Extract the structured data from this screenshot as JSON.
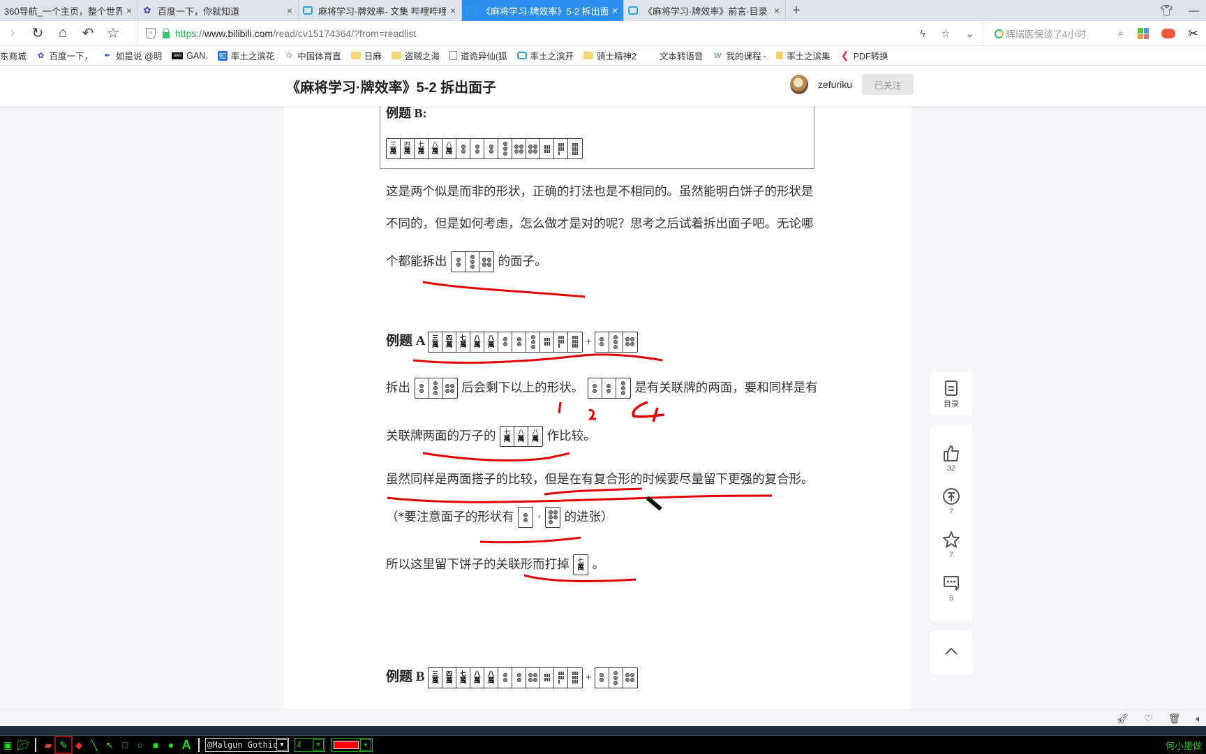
{
  "browser": {
    "tabs": [
      {
        "label": "360导航_一个主页，整个世界",
        "icon": "globe-icon",
        "active": false
      },
      {
        "label": "百度一下，你就知道",
        "icon": "baidu-paw-icon",
        "active": false
      },
      {
        "label": "麻将学习·牌效率- 文集 哔哩哔哩",
        "icon": "bilibili-tv-icon",
        "active": false
      },
      {
        "label": "《麻将学习·牌效率》5-2 拆出面子",
        "icon": "bilibili-tv-icon",
        "active": true
      },
      {
        "label": "《麻将学习·牌效率》前言·目录",
        "icon": "bilibili-tv-icon",
        "active": false
      }
    ],
    "close_glyph": "×",
    "new_tab_glyph": "+",
    "url": {
      "scheme": "https",
      "sep": "://",
      "host": "www.bilibili.com",
      "path": "/read/cv15174364/?from=readlist"
    },
    "search_placeholder": "辉瑞医保谈了4小时",
    "bookmarks": [
      {
        "label": "东商城",
        "icon": "none"
      },
      {
        "label": "百度一下，",
        "icon": "baidu-paw-icon"
      },
      {
        "label": "如是说 @明",
        "icon": "quill-icon"
      },
      {
        "label": "GAN.",
        "icon": "gan-icon"
      },
      {
        "label": "率土之滨花",
        "icon": "zhihu-icon"
      },
      {
        "label": "中国体育直",
        "icon": "star-badge-icon"
      },
      {
        "label": "日麻",
        "icon": "folder-icon"
      },
      {
        "label": "盗贼之海",
        "icon": "folder-icon"
      },
      {
        "label": "道诡异仙(狐",
        "icon": "page-icon"
      },
      {
        "label": "率土之滨开",
        "icon": "bilibili-tv-icon"
      },
      {
        "label": "骑士精神2",
        "icon": "folder-icon"
      },
      {
        "label": "文本转语音",
        "icon": "microsoft-icon"
      },
      {
        "label": "我的课程 -",
        "icon": "wings-icon"
      },
      {
        "label": "率土之滨集",
        "icon": "note-icon"
      },
      {
        "label": "PDF转换",
        "icon": "pdf-icon"
      }
    ]
  },
  "page": {
    "title": "《麻将学习·牌效率》5-2 拆出面子",
    "author": "zefuriku",
    "follow_label": "已关注"
  },
  "article": {
    "example_b_box_label": "例题 B:",
    "example_b_box_tiles": [
      "3m",
      "4m",
      "7m",
      "8m",
      "8m",
      "2p",
      "2p",
      "2p",
      "3p",
      "4p",
      "4p",
      "6s",
      "7s",
      "9s"
    ],
    "p1_line1": "这是两个似是而非的形状，正确的打法也是不相同的。虽然能明白饼子的形状是",
    "p1_line2": "不同的，但是如何考虑，怎么做才是对的呢？思考之后试着拆出面子吧。无论哪",
    "p1_line3_a": "个都能拆出",
    "p1_line3_tiles": [
      "2p",
      "3p",
      "4p"
    ],
    "p1_line3_b": "的面子。",
    "example_a_label": "例题 A",
    "example_a_tiles": [
      "3m",
      "4m",
      "7m",
      "8m",
      "8m",
      "2p",
      "2p",
      "3p",
      "6s",
      "7s",
      "9s"
    ],
    "example_a_plus": "+",
    "example_a_extra": [
      "2p",
      "3p",
      "4p"
    ],
    "p2_a": "拆出",
    "p2_tiles1": [
      "2p",
      "3p",
      "4p"
    ],
    "p2_b": "后会剩下以上的形状。",
    "p2_tiles2": [
      "2p",
      "2p",
      "3p"
    ],
    "p2_c": "是有关联牌的两面，要和同样是有",
    "p3_a": "关联牌两面的万子的",
    "p3_tiles": [
      "7m",
      "8m",
      "8m"
    ],
    "p3_b": "作比较。",
    "p4": "虽然同样是两面搭子的比较，但是在有复合形的时候要尽量留下更强的复合形。",
    "p5_a": "（*要注意面子的形状有",
    "p5_tile1": [
      "2p"
    ],
    "p5_dot": "·",
    "p5_tile2": [
      "5p"
    ],
    "p5_b": "的进张）",
    "p6_a": "所以这里留下饼子的关联形而打掉",
    "p6_tile": [
      "7m"
    ],
    "p6_b": "。",
    "example_b_label": "例题 B",
    "example_b_tiles": [
      "3m",
      "4m",
      "7m",
      "8m",
      "8m",
      "2p",
      "2p",
      "4p",
      "6s",
      "7s",
      "9s"
    ],
    "example_b_plus": "+",
    "example_b_extra": [
      "2p",
      "3p",
      "4p"
    ],
    "annotations": [
      "1",
      "2",
      "4"
    ]
  },
  "floatbar": {
    "toc_label": "目录",
    "like_count": "32",
    "coin_count": "7",
    "fav_count": "7",
    "comment_count": "5"
  },
  "drawbar": {
    "font": "@Malgun Gothic",
    "size": "4",
    "color": "#ff0000",
    "right_text": "何小墨做"
  }
}
